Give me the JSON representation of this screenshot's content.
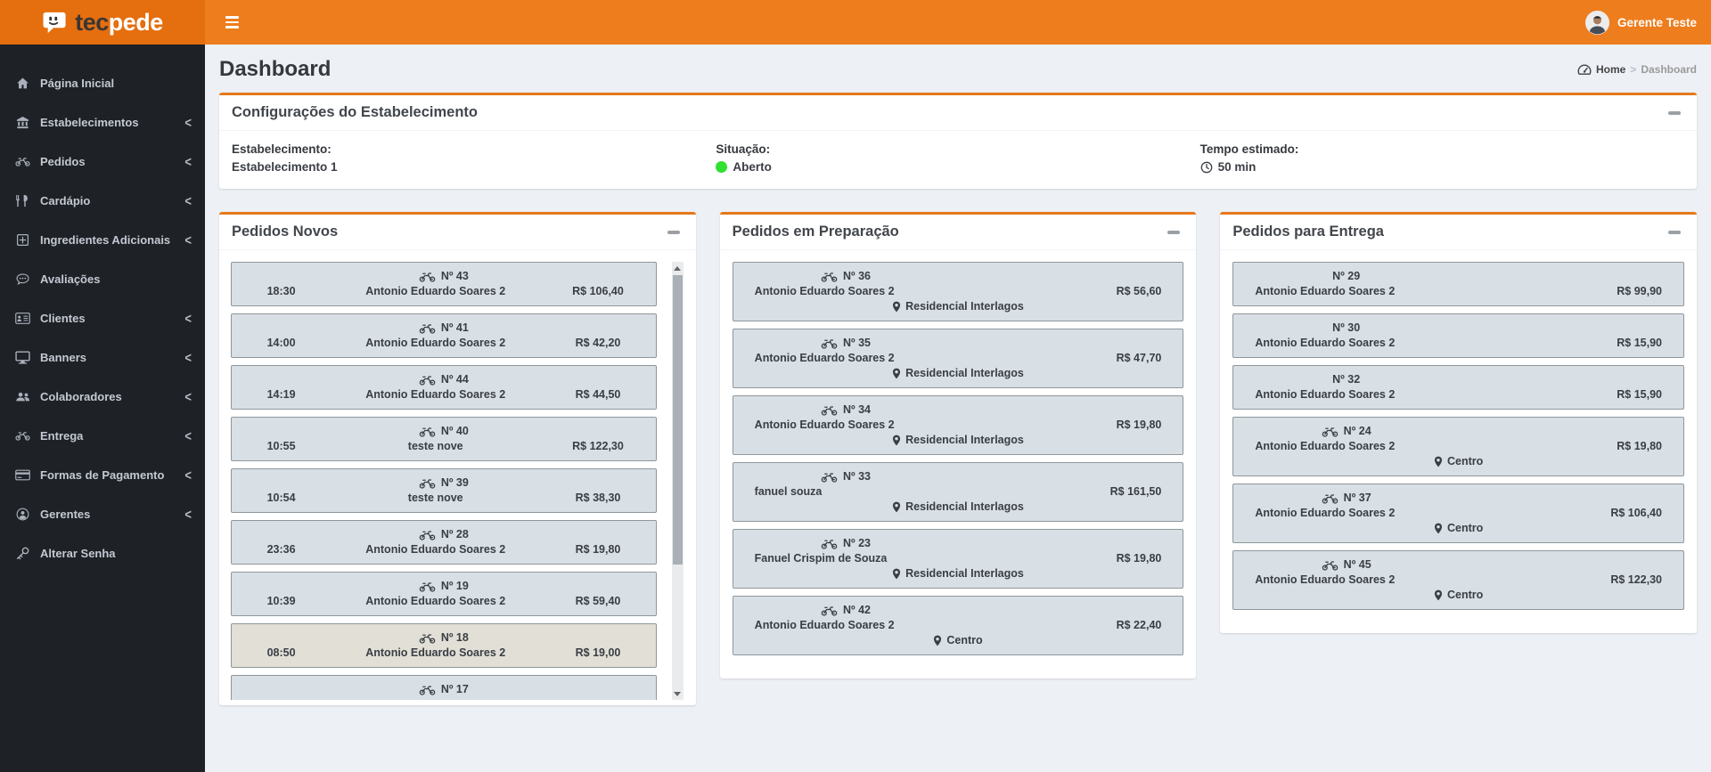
{
  "brand": {
    "name_left": "tec",
    "name_right": "pede"
  },
  "topbar": {
    "user": "Gerente Teste"
  },
  "sidebar": [
    {
      "label": "Página Inicial",
      "icon": "home-icon",
      "chevron": false
    },
    {
      "label": "Estabelecimentos",
      "icon": "bank-icon",
      "chevron": true
    },
    {
      "label": "Pedidos",
      "icon": "motorcycle-icon",
      "chevron": true
    },
    {
      "label": "Cardápio",
      "icon": "utensils-icon",
      "chevron": true
    },
    {
      "label": "Ingredientes Adicionais",
      "icon": "plus-square-icon",
      "chevron": true
    },
    {
      "label": "Avaliações",
      "icon": "comments-icon",
      "chevron": false
    },
    {
      "label": "Clientes",
      "icon": "id-card-icon",
      "chevron": true
    },
    {
      "label": "Banners",
      "icon": "desktop-icon",
      "chevron": true
    },
    {
      "label": "Colaboradores",
      "icon": "users-icon",
      "chevron": true
    },
    {
      "label": "Entrega",
      "icon": "motorcycle-icon",
      "chevron": true
    },
    {
      "label": "Formas de Pagamento",
      "icon": "credit-card-icon",
      "chevron": true
    },
    {
      "label": "Gerentes",
      "icon": "user-circle-icon",
      "chevron": true
    },
    {
      "label": "Alterar Senha",
      "icon": "key-icon",
      "chevron": false
    }
  ],
  "page": {
    "title": "Dashboard",
    "breadcrumb": {
      "home": "Home",
      "separator": ">",
      "current": "Dashboard"
    }
  },
  "config": {
    "title": "Configurações do Estabelecimento",
    "fields": [
      {
        "label": "Estabelecimento:",
        "value": "Estabelecimento 1",
        "icon": null
      },
      {
        "label": "Situação:",
        "value": "Aberto",
        "icon": "status-dot"
      },
      {
        "label": "Tempo estimado:",
        "value": "50 min",
        "icon": "clock-icon"
      }
    ]
  },
  "boards": [
    {
      "title": "Pedidos Novos",
      "orders": [
        {
          "number": "Nº 43",
          "time": "18:30",
          "customer": "Antonio Eduardo Soares 2",
          "total": "R$ 106,40",
          "bike": true
        },
        {
          "number": "Nº 41",
          "time": "14:00",
          "customer": "Antonio Eduardo Soares 2",
          "total": "R$ 42,20",
          "bike": true
        },
        {
          "number": "Nº 44",
          "time": "14:19",
          "customer": "Antonio Eduardo Soares 2",
          "total": "R$ 44,50",
          "bike": true
        },
        {
          "number": "Nº 40",
          "time": "10:55",
          "customer": "teste nove",
          "total": "R$ 122,30",
          "bike": true
        },
        {
          "number": "Nº 39",
          "time": "10:54",
          "customer": "teste nove",
          "total": "R$ 38,30",
          "bike": true
        },
        {
          "number": "Nº 28",
          "time": "23:36",
          "customer": "Antonio Eduardo Soares 2",
          "total": "R$ 19,80",
          "bike": true
        },
        {
          "number": "Nº 19",
          "time": "10:39",
          "customer": "Antonio Eduardo Soares 2",
          "total": "R$ 59,40",
          "bike": true
        },
        {
          "number": "Nº 18",
          "time": "08:50",
          "customer": "Antonio Eduardo Soares 2",
          "total": "R$ 19,00",
          "bike": true,
          "highlight": true
        },
        {
          "number": "Nº 17",
          "time": "",
          "customer": "",
          "total": "",
          "bike": true
        }
      ]
    },
    {
      "title": "Pedidos em Preparação",
      "orders": [
        {
          "number": "Nº 36",
          "customer": "Antonio Eduardo Soares 2",
          "total": "R$ 56,60",
          "bike": true,
          "location": "Residencial Interlagos"
        },
        {
          "number": "Nº 35",
          "customer": "Antonio Eduardo Soares 2",
          "total": "R$ 47,70",
          "bike": true,
          "location": "Residencial Interlagos"
        },
        {
          "number": "Nº 34",
          "customer": "Antonio Eduardo Soares 2",
          "total": "R$ 19,80",
          "bike": true,
          "location": "Residencial Interlagos"
        },
        {
          "number": "Nº 33",
          "customer": "fanuel souza",
          "total": "R$ 161,50",
          "bike": true,
          "location": "Residencial Interlagos"
        },
        {
          "number": "Nº 23",
          "customer": "Fanuel Crispim de Souza",
          "total": "R$ 19,80",
          "bike": true,
          "location": "Residencial Interlagos"
        },
        {
          "number": "Nº 42",
          "customer": "Antonio Eduardo Soares 2",
          "total": "R$ 22,40",
          "bike": true,
          "location": "Centro"
        }
      ]
    },
    {
      "title": "Pedidos para Entrega",
      "orders": [
        {
          "number": "Nº 29",
          "customer": "Antonio Eduardo Soares 2",
          "total": "R$ 99,90",
          "bike": false
        },
        {
          "number": "Nº 30",
          "customer": "Antonio Eduardo Soares 2",
          "total": "R$ 15,90",
          "bike": false
        },
        {
          "number": "Nº 32",
          "customer": "Antonio Eduardo Soares 2",
          "total": "R$ 15,90",
          "bike": false
        },
        {
          "number": "Nº 24",
          "customer": "Antonio Eduardo Soares 2",
          "total": "R$ 19,80",
          "bike": true,
          "location": "Centro"
        },
        {
          "number": "Nº 37",
          "customer": "Antonio Eduardo Soares 2",
          "total": "R$ 106,40",
          "bike": true,
          "location": "Centro"
        },
        {
          "number": "Nº 45",
          "customer": "Antonio Eduardo Soares 2",
          "total": "R$ 122,30",
          "bike": true,
          "location": "Centro"
        }
      ]
    }
  ],
  "colors": {
    "accent": "#e4791b",
    "navbar": "#ee7d1d",
    "logo_bg": "#e56e0e",
    "sidebar_bg": "#1e2126",
    "sidebar_text": "#c3c9d2",
    "page_bg": "#edf0f5",
    "card_bg": "#d8e0e5",
    "card_border": "#8f979c",
    "card_highlight_bg": "#e1dfd6",
    "status_open": "#31e031",
    "text_dark": "#3a3e44"
  }
}
